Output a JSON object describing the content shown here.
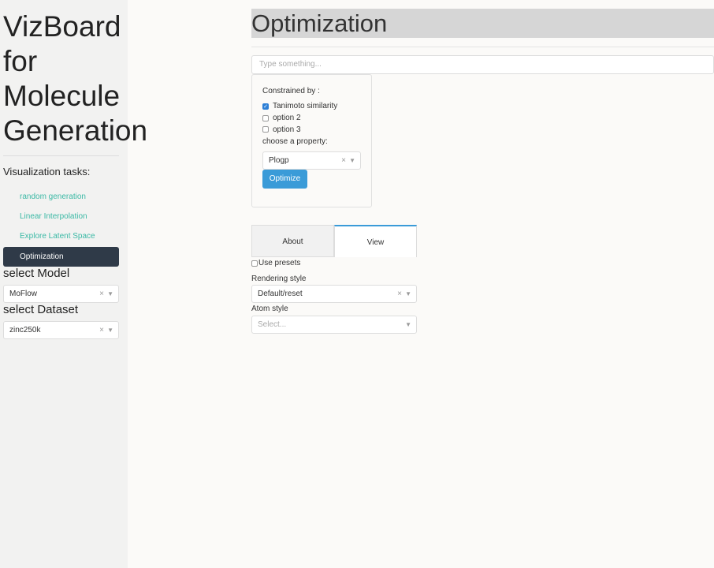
{
  "sidebar": {
    "title": [
      "VizBoard",
      "for",
      "Molecule",
      "Generation"
    ],
    "tasks_label": "Visualization tasks:",
    "items": [
      {
        "label": "random generation"
      },
      {
        "label": "Linear Interpolation"
      },
      {
        "label": "Explore Latent Space"
      },
      {
        "label": "Optimization"
      }
    ],
    "model_label": "select Model",
    "model_value": "MoFlow",
    "dataset_label": "select Dataset",
    "dataset_value": "zinc250k",
    "clear": "×"
  },
  "main": {
    "title": "Optimization",
    "search_placeholder": "Type something...",
    "constrained_label": "Constrained by :",
    "options": [
      {
        "label": "Tanimoto similarity",
        "checked": true
      },
      {
        "label": "option 2",
        "checked": false
      },
      {
        "label": "option 3",
        "checked": false
      }
    ],
    "property_label": "choose a property:",
    "property_value": "Plogp",
    "optimize_label": "Optimize",
    "tabs": [
      {
        "label": "About"
      },
      {
        "label": "View"
      }
    ],
    "use_presets": "Use presets",
    "rendering_label": "Rendering style",
    "rendering_value": "Default/reset",
    "atom_label": "Atom style",
    "atom_placeholder": "Select..."
  }
}
